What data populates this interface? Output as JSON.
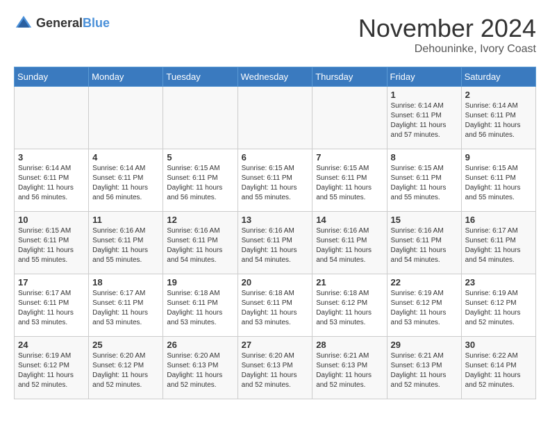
{
  "header": {
    "logo_line1": "General",
    "logo_line2": "Blue",
    "month": "November 2024",
    "location": "Dehouninke, Ivory Coast"
  },
  "weekdays": [
    "Sunday",
    "Monday",
    "Tuesday",
    "Wednesday",
    "Thursday",
    "Friday",
    "Saturday"
  ],
  "weeks": [
    [
      {
        "day": "",
        "info": ""
      },
      {
        "day": "",
        "info": ""
      },
      {
        "day": "",
        "info": ""
      },
      {
        "day": "",
        "info": ""
      },
      {
        "day": "",
        "info": ""
      },
      {
        "day": "1",
        "info": "Sunrise: 6:14 AM\nSunset: 6:11 PM\nDaylight: 11 hours and 57 minutes."
      },
      {
        "day": "2",
        "info": "Sunrise: 6:14 AM\nSunset: 6:11 PM\nDaylight: 11 hours and 56 minutes."
      }
    ],
    [
      {
        "day": "3",
        "info": "Sunrise: 6:14 AM\nSunset: 6:11 PM\nDaylight: 11 hours and 56 minutes."
      },
      {
        "day": "4",
        "info": "Sunrise: 6:14 AM\nSunset: 6:11 PM\nDaylight: 11 hours and 56 minutes."
      },
      {
        "day": "5",
        "info": "Sunrise: 6:15 AM\nSunset: 6:11 PM\nDaylight: 11 hours and 56 minutes."
      },
      {
        "day": "6",
        "info": "Sunrise: 6:15 AM\nSunset: 6:11 PM\nDaylight: 11 hours and 55 minutes."
      },
      {
        "day": "7",
        "info": "Sunrise: 6:15 AM\nSunset: 6:11 PM\nDaylight: 11 hours and 55 minutes."
      },
      {
        "day": "8",
        "info": "Sunrise: 6:15 AM\nSunset: 6:11 PM\nDaylight: 11 hours and 55 minutes."
      },
      {
        "day": "9",
        "info": "Sunrise: 6:15 AM\nSunset: 6:11 PM\nDaylight: 11 hours and 55 minutes."
      }
    ],
    [
      {
        "day": "10",
        "info": "Sunrise: 6:15 AM\nSunset: 6:11 PM\nDaylight: 11 hours and 55 minutes."
      },
      {
        "day": "11",
        "info": "Sunrise: 6:16 AM\nSunset: 6:11 PM\nDaylight: 11 hours and 55 minutes."
      },
      {
        "day": "12",
        "info": "Sunrise: 6:16 AM\nSunset: 6:11 PM\nDaylight: 11 hours and 54 minutes."
      },
      {
        "day": "13",
        "info": "Sunrise: 6:16 AM\nSunset: 6:11 PM\nDaylight: 11 hours and 54 minutes."
      },
      {
        "day": "14",
        "info": "Sunrise: 6:16 AM\nSunset: 6:11 PM\nDaylight: 11 hours and 54 minutes."
      },
      {
        "day": "15",
        "info": "Sunrise: 6:16 AM\nSunset: 6:11 PM\nDaylight: 11 hours and 54 minutes."
      },
      {
        "day": "16",
        "info": "Sunrise: 6:17 AM\nSunset: 6:11 PM\nDaylight: 11 hours and 54 minutes."
      }
    ],
    [
      {
        "day": "17",
        "info": "Sunrise: 6:17 AM\nSunset: 6:11 PM\nDaylight: 11 hours and 53 minutes."
      },
      {
        "day": "18",
        "info": "Sunrise: 6:17 AM\nSunset: 6:11 PM\nDaylight: 11 hours and 53 minutes."
      },
      {
        "day": "19",
        "info": "Sunrise: 6:18 AM\nSunset: 6:11 PM\nDaylight: 11 hours and 53 minutes."
      },
      {
        "day": "20",
        "info": "Sunrise: 6:18 AM\nSunset: 6:11 PM\nDaylight: 11 hours and 53 minutes."
      },
      {
        "day": "21",
        "info": "Sunrise: 6:18 AM\nSunset: 6:12 PM\nDaylight: 11 hours and 53 minutes."
      },
      {
        "day": "22",
        "info": "Sunrise: 6:19 AM\nSunset: 6:12 PM\nDaylight: 11 hours and 53 minutes."
      },
      {
        "day": "23",
        "info": "Sunrise: 6:19 AM\nSunset: 6:12 PM\nDaylight: 11 hours and 52 minutes."
      }
    ],
    [
      {
        "day": "24",
        "info": "Sunrise: 6:19 AM\nSunset: 6:12 PM\nDaylight: 11 hours and 52 minutes."
      },
      {
        "day": "25",
        "info": "Sunrise: 6:20 AM\nSunset: 6:12 PM\nDaylight: 11 hours and 52 minutes."
      },
      {
        "day": "26",
        "info": "Sunrise: 6:20 AM\nSunset: 6:13 PM\nDaylight: 11 hours and 52 minutes."
      },
      {
        "day": "27",
        "info": "Sunrise: 6:20 AM\nSunset: 6:13 PM\nDaylight: 11 hours and 52 minutes."
      },
      {
        "day": "28",
        "info": "Sunrise: 6:21 AM\nSunset: 6:13 PM\nDaylight: 11 hours and 52 minutes."
      },
      {
        "day": "29",
        "info": "Sunrise: 6:21 AM\nSunset: 6:13 PM\nDaylight: 11 hours and 52 minutes."
      },
      {
        "day": "30",
        "info": "Sunrise: 6:22 AM\nSunset: 6:14 PM\nDaylight: 11 hours and 52 minutes."
      }
    ]
  ]
}
